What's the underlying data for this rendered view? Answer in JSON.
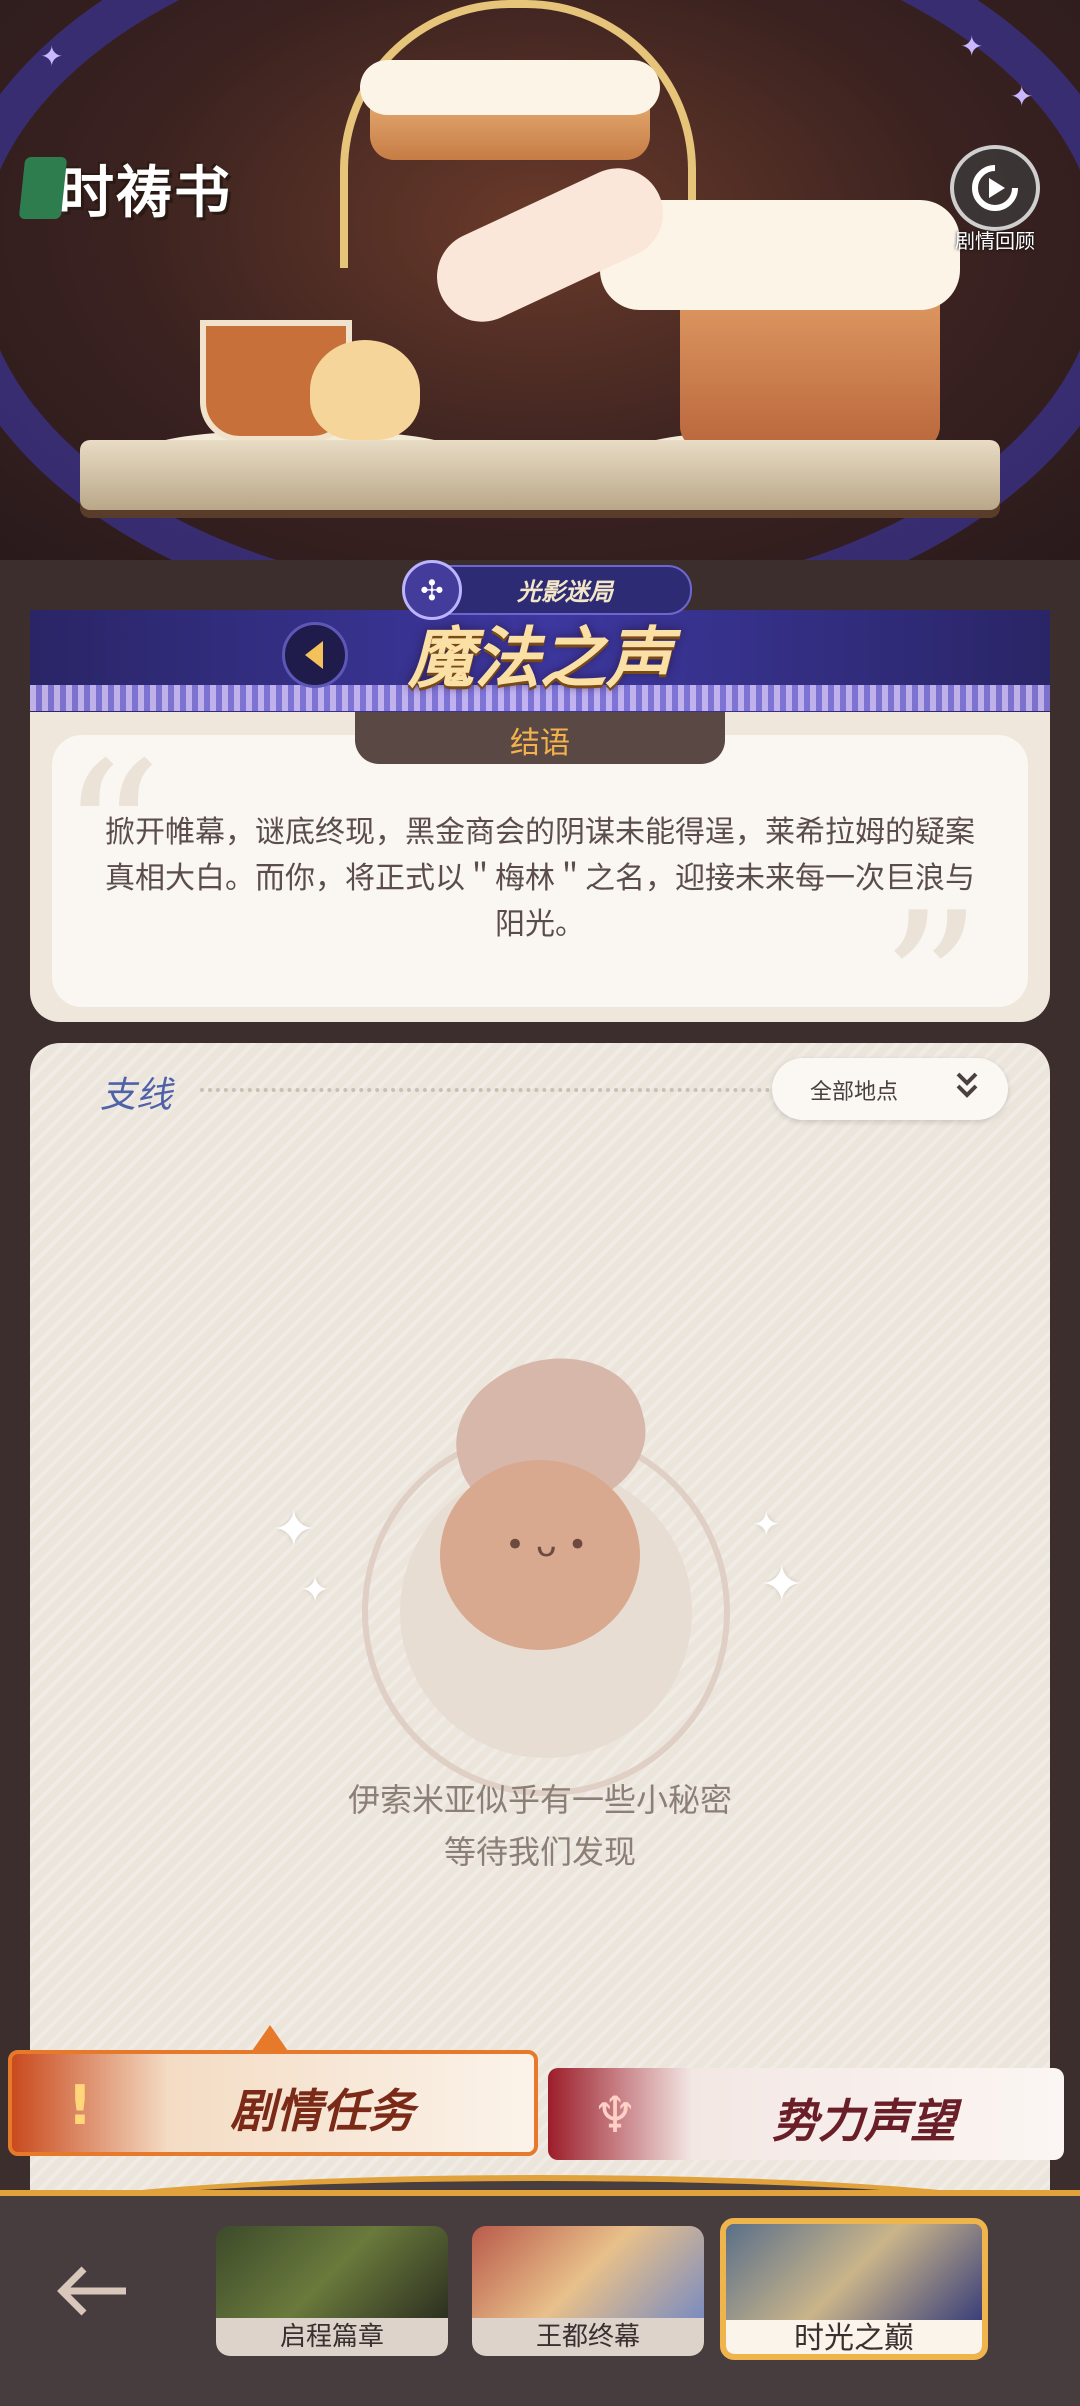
{
  "header": {
    "logo_text": "时祷书",
    "replay_label": "剧情回顾"
  },
  "chapter_banner": {
    "category": "光影迷局",
    "title": "魔法之声"
  },
  "conclusion": {
    "tag": "结语",
    "text": "掀开帷幕，谜底终现，黑金商会的阴谋未能得逞，莱希拉姆的疑案真相大白。而你，将正式以＂梅林＂之名，迎接未来每一次巨浪与阳光。"
  },
  "side_quests": {
    "title": "支线",
    "filter_label": "全部地点",
    "empty_line1": "伊索米亚似乎有一些小秘密",
    "empty_line2": "等待我们发现"
  },
  "tabs": [
    {
      "label": "剧情任务",
      "icon": "story-mission-icon",
      "active": true
    },
    {
      "label": "势力声望",
      "icon": "faction-reputation-icon",
      "active": false
    }
  ],
  "chapters": [
    {
      "label": "启程篇章",
      "active": false
    },
    {
      "label": "王都终幕",
      "active": false
    },
    {
      "label": "时光之巅",
      "active": true
    }
  ],
  "colors": {
    "accent": "#e1a23b",
    "band": "#3d38a0",
    "tag_text": "#f3b24d",
    "side_title": "#4f62a8"
  }
}
